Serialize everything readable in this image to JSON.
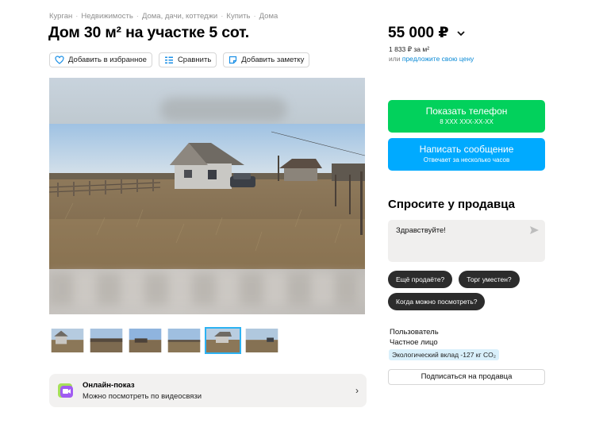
{
  "breadcrumb": {
    "items": [
      "Курган",
      "Недвижимость",
      "Дома, дачи, коттеджи",
      "Купить",
      "Дома"
    ],
    "separator": "·"
  },
  "listing": {
    "title": "Дом 30 м² на участке 5 сот."
  },
  "actions": {
    "favorite_label": "Добавить в избранное",
    "compare_label": "Сравнить",
    "note_label": "Добавить заметку"
  },
  "gallery": {
    "thumbnail_count": 6,
    "active_thumbnail_index": 4
  },
  "online_view": {
    "title": "Онлайн-показ",
    "subtitle": "Можно посмотреть по видеосвязи",
    "chevron": "›"
  },
  "price": {
    "value": "55 000 ₽",
    "dropdown_glyph": "⌄",
    "per_m2": "1 833 ₽ за м²",
    "offer_prefix": "или",
    "offer_link": "предложите свою цену"
  },
  "contact": {
    "phone_label": "Показать телефон",
    "phone_masked": "8 XXX XXX-XX-XX",
    "message_label": "Написать сообщение",
    "message_sub": "Отвечает за несколько часов"
  },
  "ask": {
    "heading": "Спросите у продавца",
    "input_value": "Здравствуйте!",
    "chips": [
      "Ещё продаёте?",
      "Торг уместен?",
      "Когда можно посмотреть?"
    ]
  },
  "seller": {
    "name": "Пользователь",
    "type": "Частное лицо",
    "eco_badge": "Экологический вклад -127 кг CO₂",
    "subscribe_label": "Подписаться на продавца"
  },
  "colors": {
    "phone_button": "#02d15c",
    "message_button": "#00aaff",
    "link": "#0a8ad6",
    "chip": "#2c2c2c",
    "thumb_active": "#2cb2f2"
  }
}
